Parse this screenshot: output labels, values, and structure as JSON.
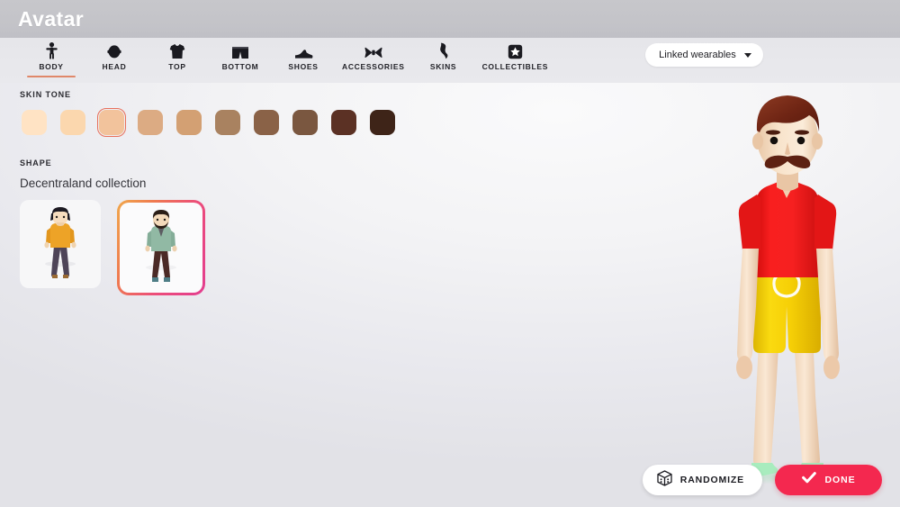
{
  "header": {
    "title": "Avatar"
  },
  "tabs": [
    {
      "label": "BODY",
      "icon": "person-icon",
      "active": true
    },
    {
      "label": "HEAD",
      "icon": "head-icon",
      "active": false
    },
    {
      "label": "TOP",
      "icon": "tshirt-icon",
      "active": false
    },
    {
      "label": "BOTTOM",
      "icon": "shorts-icon",
      "active": false
    },
    {
      "label": "SHOES",
      "icon": "shoe-icon",
      "active": false
    },
    {
      "label": "ACCESSORIES",
      "icon": "bowtie-icon",
      "active": false
    },
    {
      "label": "SKINS",
      "icon": "skin-icon",
      "active": false
    },
    {
      "label": "COLLECTIBLES",
      "icon": "star-box-icon",
      "active": false
    }
  ],
  "filter": {
    "label": "Linked wearables",
    "icon": "chevron-down-icon"
  },
  "skin_tone": {
    "label": "SKIN TONE",
    "selected_index": 2,
    "selection_color": "#e8705c",
    "swatches": [
      "#ffe3c4",
      "#fbd7ae",
      "#f2c39c",
      "#dcab83",
      "#d3a073",
      "#a98260",
      "#8a6247",
      "#7a5740",
      "#5b3124",
      "#3e2418"
    ]
  },
  "shape": {
    "label": "SHAPE",
    "collection_title": "Decentraland collection",
    "selected_index": 1,
    "cards": [
      {
        "name": "female-body-shape",
        "selected": false
      },
      {
        "name": "male-body-shape",
        "selected": true
      }
    ],
    "selection_gradient": [
      "#f0a84b",
      "#ec4d7a",
      "#e33d8f"
    ]
  },
  "avatar": {
    "hair_color": "#7c2f1e",
    "skin_color": "#f6ddc2",
    "top_color": "#ef1d1d",
    "bottom_color": "#f5cf09",
    "shoe_color": "#9ce8b4"
  },
  "actions": {
    "randomize_label": "RANDOMIZE",
    "randomize_icon": "dice-icon",
    "done_label": "DONE",
    "done_icon": "check-icon",
    "done_color": "#f4284f"
  }
}
